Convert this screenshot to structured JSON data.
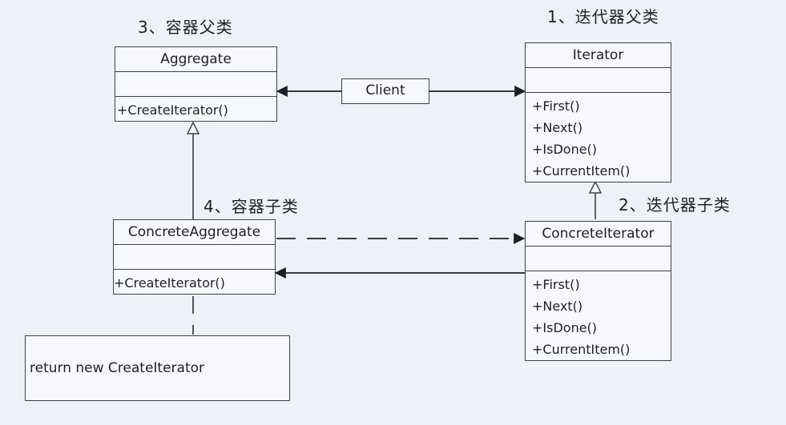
{
  "annotations": {
    "aggregate_parent": "3、容器父类",
    "iterator_parent": "1、迭代器父类",
    "aggregate_child": "4、容器子类",
    "iterator_child": "2、迭代器子类"
  },
  "client": {
    "name": "Client"
  },
  "aggregate": {
    "name": "Aggregate",
    "operations": [
      "+CreateIterator()"
    ]
  },
  "iterator": {
    "name": "Iterator",
    "operations": [
      "+First()",
      "+Next()",
      "+IsDone()",
      "+CurrentItem()"
    ]
  },
  "concrete_aggregate": {
    "name": "ConcreteAggregate",
    "operations": [
      "+CreateIterator()"
    ]
  },
  "concrete_iterator": {
    "name": "ConcreteIterator",
    "operations": [
      "+First()",
      "+Next()",
      "+IsDone()",
      "+CurrentItem()"
    ]
  },
  "note": {
    "text": "return new CreateIterator"
  }
}
